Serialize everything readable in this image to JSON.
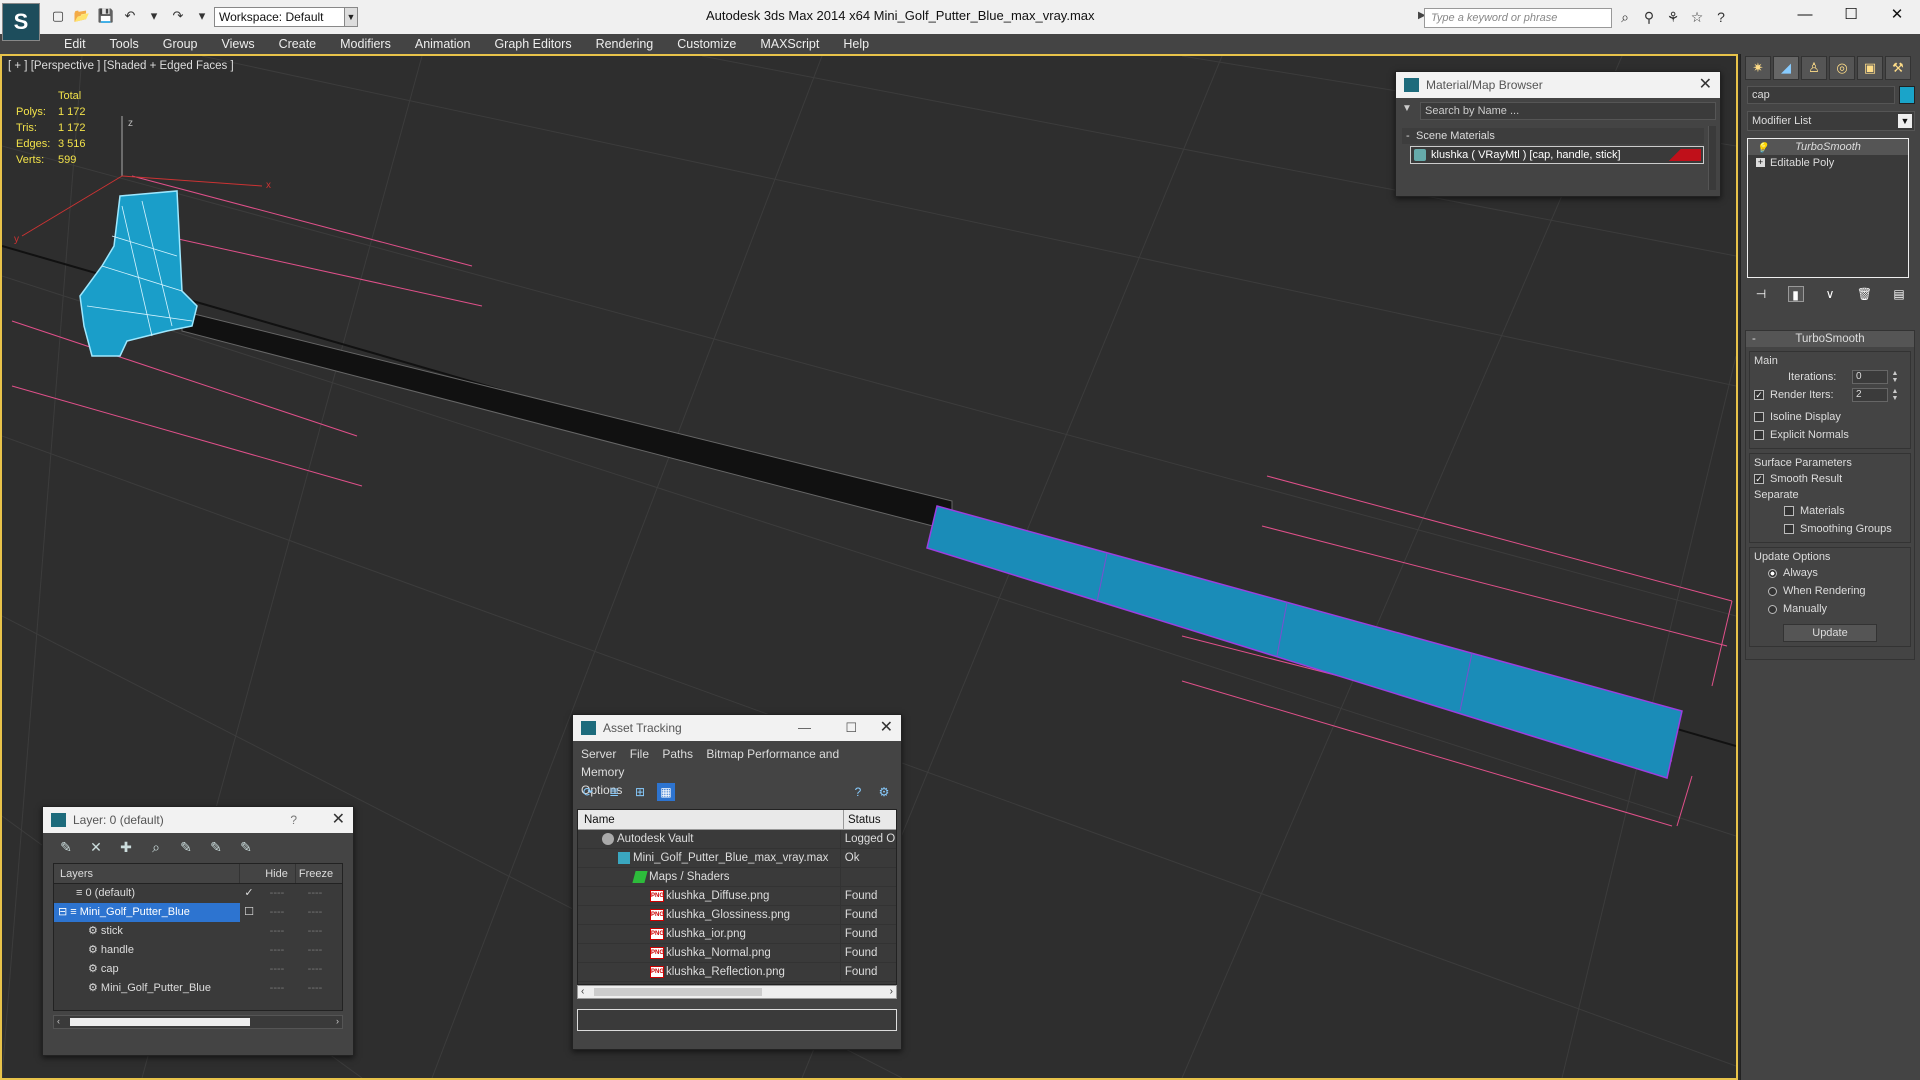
{
  "titlebar": {
    "app_logo": "S",
    "workspace": "Workspace: Default",
    "title": "Autodesk 3ds Max  2014 x64      Mini_Golf_Putter_Blue_max_vray.max",
    "search_placeholder": "Type a keyword or phrase",
    "win_minimize": "—",
    "win_maximize": "☐",
    "win_close": "✕"
  },
  "menu": [
    "Edit",
    "Tools",
    "Group",
    "Views",
    "Create",
    "Modifiers",
    "Animation",
    "Graph Editors",
    "Rendering",
    "Customize",
    "MAXScript",
    "Help"
  ],
  "viewport": {
    "label": "[ + ] [Perspective ] [Shaded + Edged Faces ]",
    "stats": {
      "total_label": "Total",
      "polys_label": "Polys:",
      "polys": "1 172",
      "tris_label": "Tris:",
      "tris": "1 172",
      "edges_label": "Edges:",
      "edges": "3 516",
      "verts_label": "Verts:",
      "verts": "599"
    },
    "axis_z": "z",
    "axis_x": "x",
    "axis_y": "y"
  },
  "material_browser": {
    "title": "Material/Map Browser",
    "search_placeholder": "Search by Name ...",
    "section": "Scene Materials",
    "item": "klushka  ( VRayMtl )  [cap, handle, stick]",
    "swatch_color": "#c0101a"
  },
  "layer_manager": {
    "title": "Layer: 0 (default)",
    "help": "?",
    "columns": [
      "Layers",
      "Hide",
      "Freeze"
    ],
    "rows": [
      {
        "name": "0 (default)",
        "indent": 1,
        "check": "✓",
        "selected": false
      },
      {
        "name": "Mini_Golf_Putter_Blue",
        "indent": 1,
        "check": "☐",
        "selected": true
      },
      {
        "name": "stick",
        "indent": 2,
        "check": "",
        "selected": false
      },
      {
        "name": "handle",
        "indent": 2,
        "check": "",
        "selected": false
      },
      {
        "name": "cap",
        "indent": 2,
        "check": "",
        "selected": false
      },
      {
        "name": "Mini_Golf_Putter_Blue",
        "indent": 2,
        "check": "",
        "selected": false
      }
    ],
    "dash": "----"
  },
  "asset_tracking": {
    "title": "Asset Tracking",
    "menu": [
      "Server",
      "File",
      "Paths",
      "Bitmap Performance and Memory",
      "Options"
    ],
    "columns": [
      "Name",
      "Status"
    ],
    "rows": [
      {
        "name": "Autodesk Vault",
        "status": "Logged O",
        "indent": 2,
        "icon": "vault"
      },
      {
        "name": "Mini_Golf_Putter_Blue_max_vray.max",
        "status": "Ok",
        "indent": 3,
        "icon": "max"
      },
      {
        "name": "Maps / Shaders",
        "status": "",
        "indent": 4,
        "icon": "maps"
      },
      {
        "name": "klushka_Diffuse.png",
        "status": "Found",
        "indent": 5,
        "icon": "png"
      },
      {
        "name": "klushka_Glossiness.png",
        "status": "Found",
        "indent": 5,
        "icon": "png"
      },
      {
        "name": "klushka_ior.png",
        "status": "Found",
        "indent": 5,
        "icon": "png"
      },
      {
        "name": "klushka_Normal.png",
        "status": "Found",
        "indent": 5,
        "icon": "png"
      },
      {
        "name": "klushka_Reflection.png",
        "status": "Found",
        "indent": 5,
        "icon": "png"
      }
    ],
    "png_label": "PNG"
  },
  "command_panel": {
    "object_name": "cap",
    "object_color": "#1aa4c9",
    "modifier_list": "Modifier List",
    "stack": [
      "TurboSmooth",
      "Editable Poly"
    ],
    "rollout_title": "TurboSmooth",
    "main_label": "Main",
    "iterations_label": "Iterations:",
    "iterations": "0",
    "render_iters_label": "Render Iters:",
    "render_iters": "2",
    "isoline_label": "Isoline Display",
    "explicit_normals_label": "Explicit Normals",
    "surface_params_label": "Surface Parameters",
    "smooth_result_label": "Smooth Result",
    "separate_label": "Separate",
    "materials_label": "Materials",
    "smoothing_groups_label": "Smoothing Groups",
    "update_options_label": "Update Options",
    "always_label": "Always",
    "when_rendering_label": "When Rendering",
    "manually_label": "Manually",
    "update_button": "Update"
  }
}
